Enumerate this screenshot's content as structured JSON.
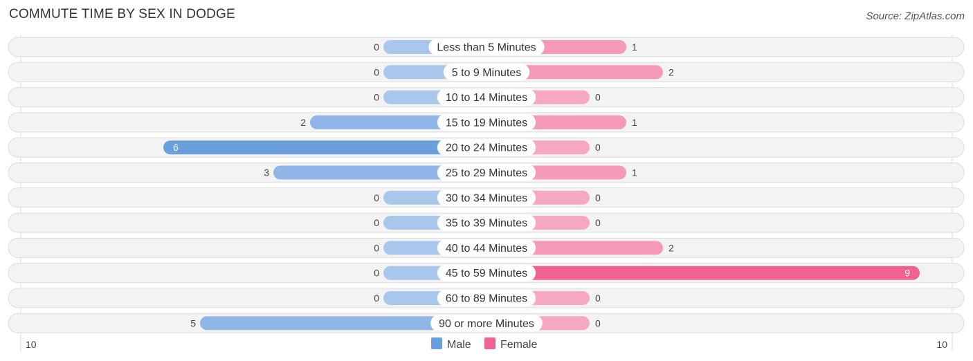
{
  "header": {
    "title": "COMMUTE TIME BY SEX IN DODGE",
    "source": "Source: ZipAtlas.com"
  },
  "chart_data": {
    "type": "bar",
    "orientation": "horizontal-diverging",
    "title": "COMMUTE TIME BY SEX IN DODGE",
    "categories": [
      "Less than 5 Minutes",
      "5 to 9 Minutes",
      "10 to 14 Minutes",
      "15 to 19 Minutes",
      "20 to 24 Minutes",
      "25 to 29 Minutes",
      "30 to 34 Minutes",
      "35 to 39 Minutes",
      "40 to 44 Minutes",
      "45 to 59 Minutes",
      "60 to 89 Minutes",
      "90 or more Minutes"
    ],
    "series": [
      {
        "name": "Male",
        "color": "#6a9fdb",
        "light_color": "#a9c6ec",
        "values": [
          0,
          0,
          0,
          2,
          6,
          3,
          0,
          0,
          0,
          0,
          0,
          5
        ]
      },
      {
        "name": "Female",
        "color": "#f06292",
        "light_color": "#f6a8c2",
        "values": [
          1,
          2,
          0,
          1,
          0,
          1,
          0,
          0,
          2,
          9,
          0,
          0
        ]
      }
    ],
    "axis": {
      "left_label": "10",
      "right_label": "10",
      "max": 10
    },
    "legend": {
      "position": "bottom-center",
      "items": [
        "Male",
        "Female"
      ]
    }
  }
}
